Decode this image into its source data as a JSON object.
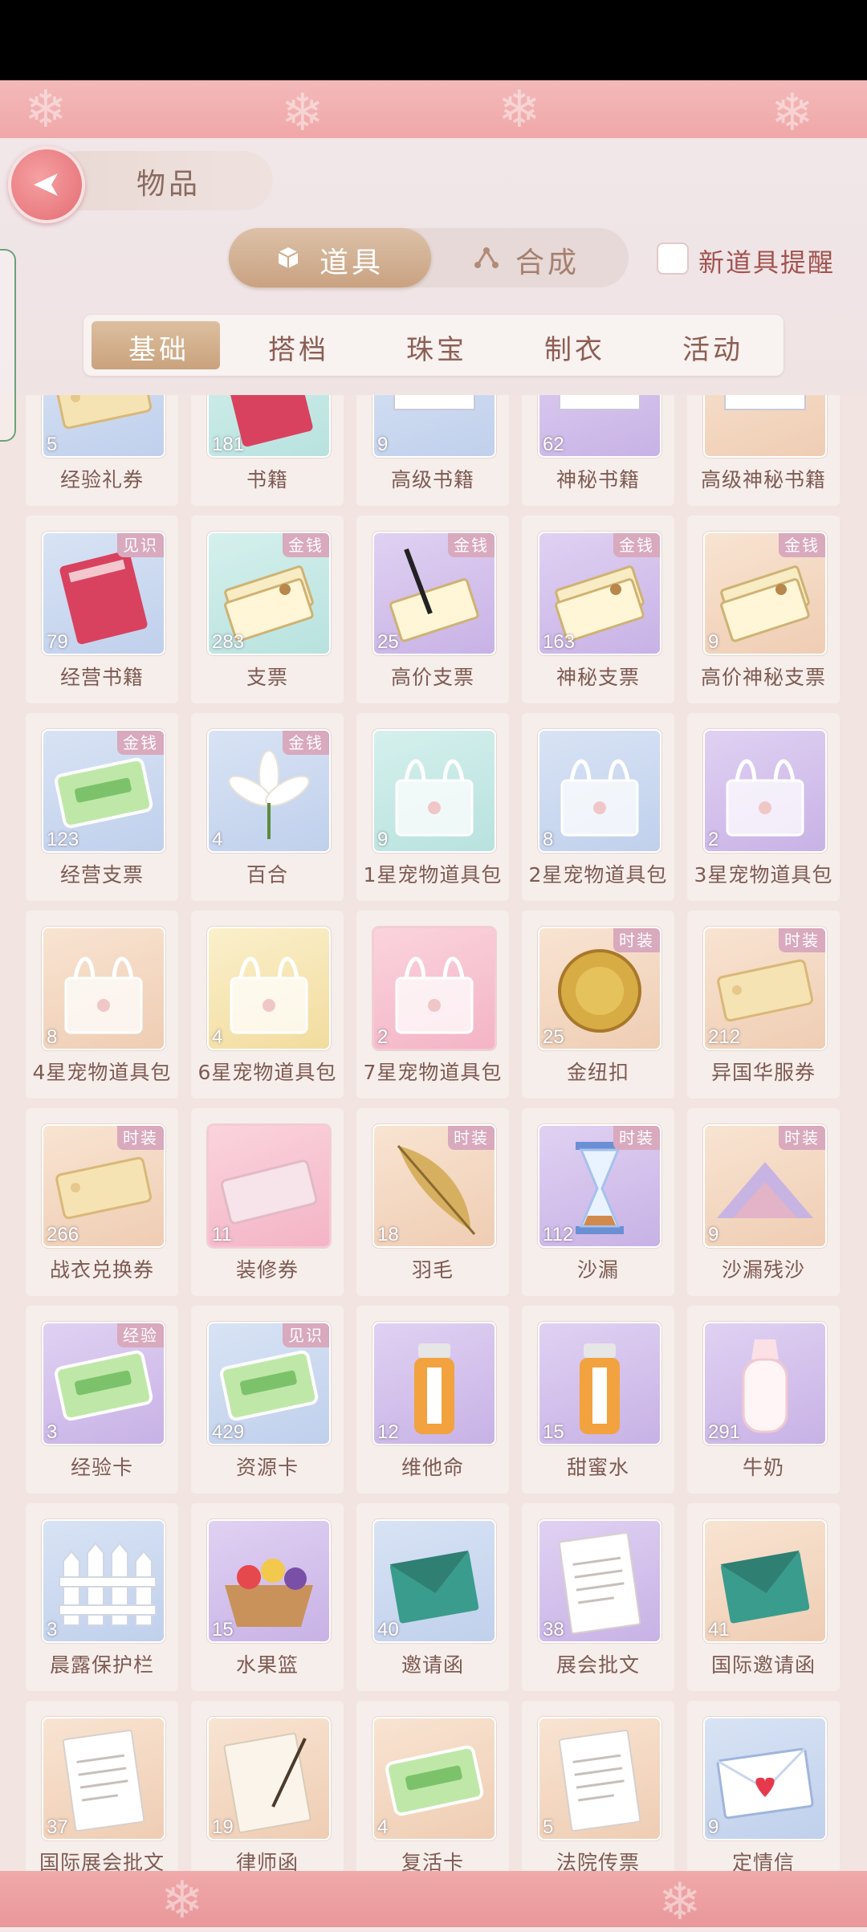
{
  "header": {
    "title": "物品",
    "tabs": [
      {
        "label": "道具",
        "active": true
      },
      {
        "label": "合成",
        "active": false
      }
    ],
    "new_item_reminder_label": "新道具提醒",
    "new_item_reminder_checked": false
  },
  "categories": [
    {
      "label": "基础",
      "active": true
    },
    {
      "label": "搭档",
      "active": false
    },
    {
      "label": "珠宝",
      "active": false
    },
    {
      "label": "制衣",
      "active": false
    },
    {
      "label": "活动",
      "active": false
    }
  ],
  "items": [
    {
      "name": "经验礼券",
      "count": "5",
      "badge": "",
      "icon": "ticket-icon"
    },
    {
      "name": "书籍",
      "count": "181",
      "badge": "",
      "icon": "book-icon"
    },
    {
      "name": "高级书籍",
      "count": "9",
      "badge": "",
      "icon": "book-stack-icon"
    },
    {
      "name": "神秘书籍",
      "count": "62",
      "badge": "",
      "icon": "book-stack-icon"
    },
    {
      "name": "高级神秘书籍",
      "count": "",
      "badge": "",
      "icon": "book-stack-icon"
    },
    {
      "name": "经营书籍",
      "count": "79",
      "badge": "见识",
      "icon": "book-icon"
    },
    {
      "name": "支票",
      "count": "283",
      "badge": "金钱",
      "icon": "cheque-icon"
    },
    {
      "name": "高价支票",
      "count": "25",
      "badge": "金钱",
      "icon": "cheque-pen-icon"
    },
    {
      "name": "神秘支票",
      "count": "163",
      "badge": "金钱",
      "icon": "cheque-icon"
    },
    {
      "name": "高价神秘支票",
      "count": "9",
      "badge": "金钱",
      "icon": "cheque-icon"
    },
    {
      "name": "经营支票",
      "count": "123",
      "badge": "金钱",
      "icon": "card-icon"
    },
    {
      "name": "百合",
      "count": "4",
      "badge": "金钱",
      "icon": "lily-icon"
    },
    {
      "name": "1星宠物道具包",
      "count": "9",
      "badge": "",
      "icon": "gift-bag-icon"
    },
    {
      "name": "2星宠物道具包",
      "count": "8",
      "badge": "",
      "icon": "gift-bag-icon"
    },
    {
      "name": "3星宠物道具包",
      "count": "2",
      "badge": "",
      "icon": "gift-bag-icon"
    },
    {
      "name": "4星宠物道具包",
      "count": "8",
      "badge": "",
      "icon": "gift-bag-icon"
    },
    {
      "name": "6星宠物道具包",
      "count": "4",
      "badge": "",
      "icon": "gift-bag-icon"
    },
    {
      "name": "7星宠物道具包",
      "count": "2",
      "badge": "",
      "icon": "gift-bag-icon"
    },
    {
      "name": "金纽扣",
      "count": "25",
      "badge": "时装",
      "icon": "gold-button-icon"
    },
    {
      "name": "异国华服券",
      "count": "212",
      "badge": "时装",
      "icon": "ticket-icon"
    },
    {
      "name": "战衣兑换券",
      "count": "266",
      "badge": "时装",
      "icon": "ticket-icon"
    },
    {
      "name": "装修券",
      "count": "11",
      "badge": "",
      "icon": "voucher-icon"
    },
    {
      "name": "羽毛",
      "count": "18",
      "badge": "时装",
      "icon": "feather-icon"
    },
    {
      "name": "沙漏",
      "count": "112",
      "badge": "时装",
      "icon": "hourglass-icon"
    },
    {
      "name": "沙漏残沙",
      "count": "9",
      "badge": "时装",
      "icon": "sand-pile-icon"
    },
    {
      "name": "经验卡",
      "count": "3",
      "badge": "经验",
      "icon": "card-icon"
    },
    {
      "name": "资源卡",
      "count": "429",
      "badge": "见识",
      "icon": "card-icon"
    },
    {
      "name": "维他命",
      "count": "12",
      "badge": "",
      "icon": "bottle-icon"
    },
    {
      "name": "甜蜜水",
      "count": "15",
      "badge": "",
      "icon": "bottle-icon"
    },
    {
      "name": "牛奶",
      "count": "291",
      "badge": "",
      "icon": "baby-bottle-icon"
    },
    {
      "name": "晨露保护栏",
      "count": "3",
      "badge": "",
      "icon": "fence-icon"
    },
    {
      "name": "水果篮",
      "count": "15",
      "badge": "",
      "icon": "fruit-basket-icon"
    },
    {
      "name": "邀请函",
      "count": "40",
      "badge": "",
      "icon": "envelope-icon"
    },
    {
      "name": "展会批文",
      "count": "38",
      "badge": "",
      "icon": "document-icon"
    },
    {
      "name": "国际邀请函",
      "count": "41",
      "badge": "",
      "icon": "envelope-icon"
    },
    {
      "name": "国际展会批文",
      "count": "37",
      "badge": "",
      "icon": "document-icon"
    },
    {
      "name": "律师函",
      "count": "19",
      "badge": "",
      "icon": "letter-quill-icon"
    },
    {
      "name": "复活卡",
      "count": "4",
      "badge": "",
      "icon": "card-icon"
    },
    {
      "name": "法院传票",
      "count": "5",
      "badge": "",
      "icon": "document-icon"
    },
    {
      "name": "定情信",
      "count": "9",
      "badge": "",
      "icon": "love-letter-icon"
    }
  ],
  "thumb_styles": [
    "blue",
    "teal",
    "blue",
    "purple",
    "peach",
    "blue",
    "teal",
    "purple",
    "purple",
    "peach",
    "blue",
    "blue",
    "teal",
    "blue",
    "purple",
    "peach",
    "yellow",
    "pink",
    "peach",
    "peach",
    "peach",
    "pink",
    "peach",
    "purple",
    "peach",
    "purple",
    "blue",
    "purple",
    "purple",
    "purple",
    "blue",
    "purple",
    "blue",
    "purple",
    "peach",
    "peach",
    "peach",
    "peach",
    "peach",
    "blue"
  ]
}
